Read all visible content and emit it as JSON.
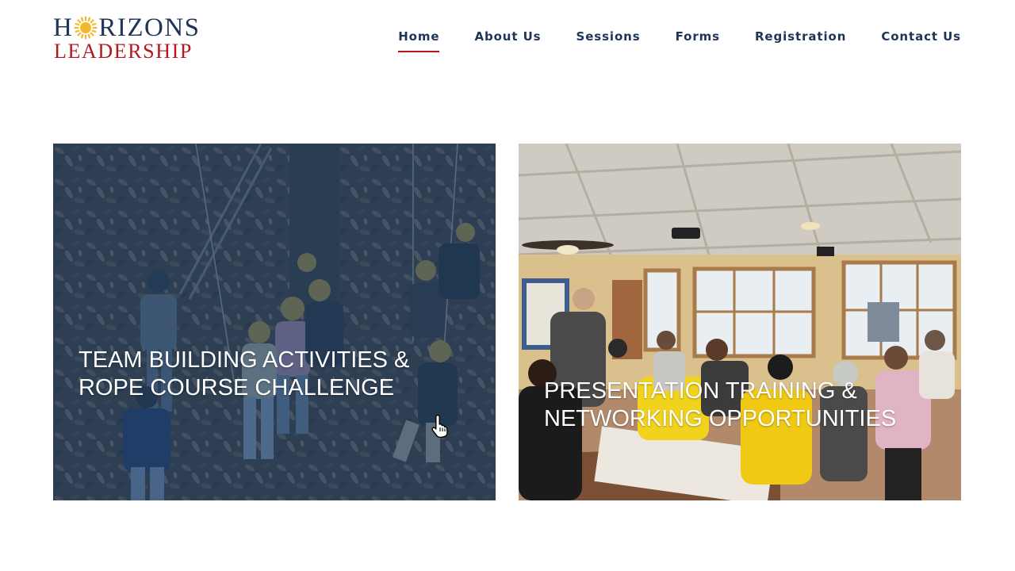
{
  "logo": {
    "line1_pre": "H",
    "line1_post": "RIZONS",
    "line2": "LEADERSHIP",
    "sun_icon": "sun-icon",
    "colors": {
      "navy": "#1f3557",
      "red": "#b3181d",
      "gold": "#f3b92b"
    }
  },
  "nav": {
    "items": [
      {
        "label": "Home",
        "active": true
      },
      {
        "label": "About Us",
        "active": false
      },
      {
        "label": "Sessions",
        "active": false
      },
      {
        "label": "Forms",
        "active": false
      },
      {
        "label": "Registration",
        "active": false
      },
      {
        "label": "Contact Us",
        "active": false
      }
    ]
  },
  "cards": [
    {
      "title_line1": "TEAM BUILDING ACTIVITIES &",
      "title_line2": "ROPE COURSE CHALLENGE",
      "overlay_color": "#1d3f66",
      "image": "outdoor rope course photo"
    },
    {
      "title_line1": "PRESENTATION TRAINING &",
      "title_line2": "NETWORKING OPPORTUNITIES",
      "image": "indoor classroom photo"
    }
  ],
  "cursor_icon": "hand-pointer-icon"
}
